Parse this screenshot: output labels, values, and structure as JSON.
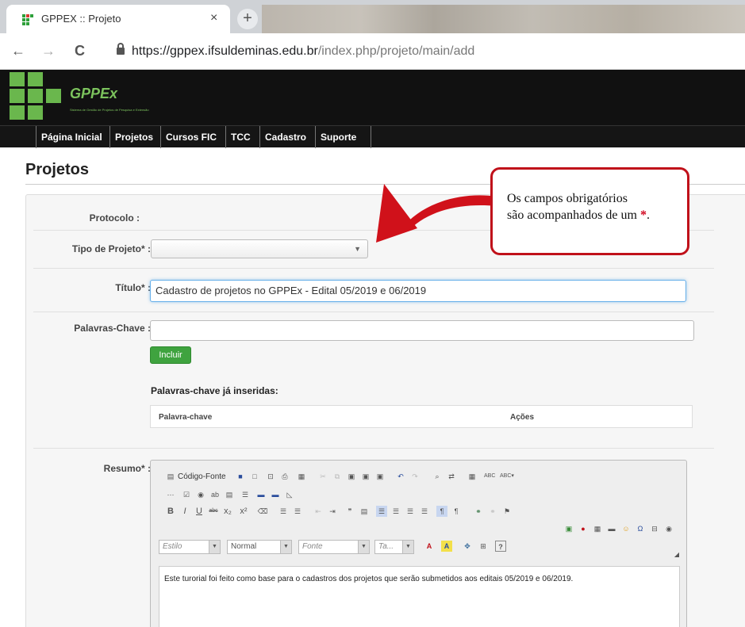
{
  "browser": {
    "tab_title": "GPPEX :: Projeto",
    "close_glyph": "×",
    "new_tab_glyph": "+",
    "url_host": "https://gppex.ifsuldeminas.edu.br",
    "url_path": "/index.php/projeto/main/add",
    "back_glyph": "←",
    "forward_glyph": "→",
    "reload_glyph": "C"
  },
  "site": {
    "logo_text": "GPPEx",
    "logo_subtitle": "Sistema de Gestão de Projetos de Pesquisa e Extensão",
    "brand_color": "#6ab74d"
  },
  "nav": {
    "items": [
      "Página Inicial",
      "Projetos",
      "Cursos FIC",
      "TCC",
      "Cadastro",
      "Suporte"
    ]
  },
  "page": {
    "title": "Projetos"
  },
  "form": {
    "protocolo_label": "Protocolo :",
    "tipo_label": "Tipo de Projeto* :",
    "tipo_value": "",
    "titulo_label": "Título* :",
    "titulo_value": "Cadastro de projetos no GPPEx - Edital 05/2019 e 06/2019",
    "palavras_label": "Palavras-Chave :",
    "palavras_value": "",
    "incluir_label": "Incluir",
    "kw_section_title": "Palavras-chave já inseridas:",
    "kw_col_keyword": "Palavra-chave",
    "kw_col_actions": "Ações",
    "resumo_label": "Resumo* :"
  },
  "editor": {
    "source_label": "Código-Fonte",
    "style_combo": "Estilo",
    "format_combo": "Normal",
    "font_combo": "Fonte",
    "size_combo": "Ta...",
    "content": "Este turorial foi feito como base para o cadastros dos projetos que serão submetidos aos editais 05/2019 e 06/2019."
  },
  "callout": {
    "line1": "Os campos obrigatórios",
    "line2": "são acompanhados de um ",
    "star": "*",
    "end": ".",
    "color": "#c0111a"
  }
}
